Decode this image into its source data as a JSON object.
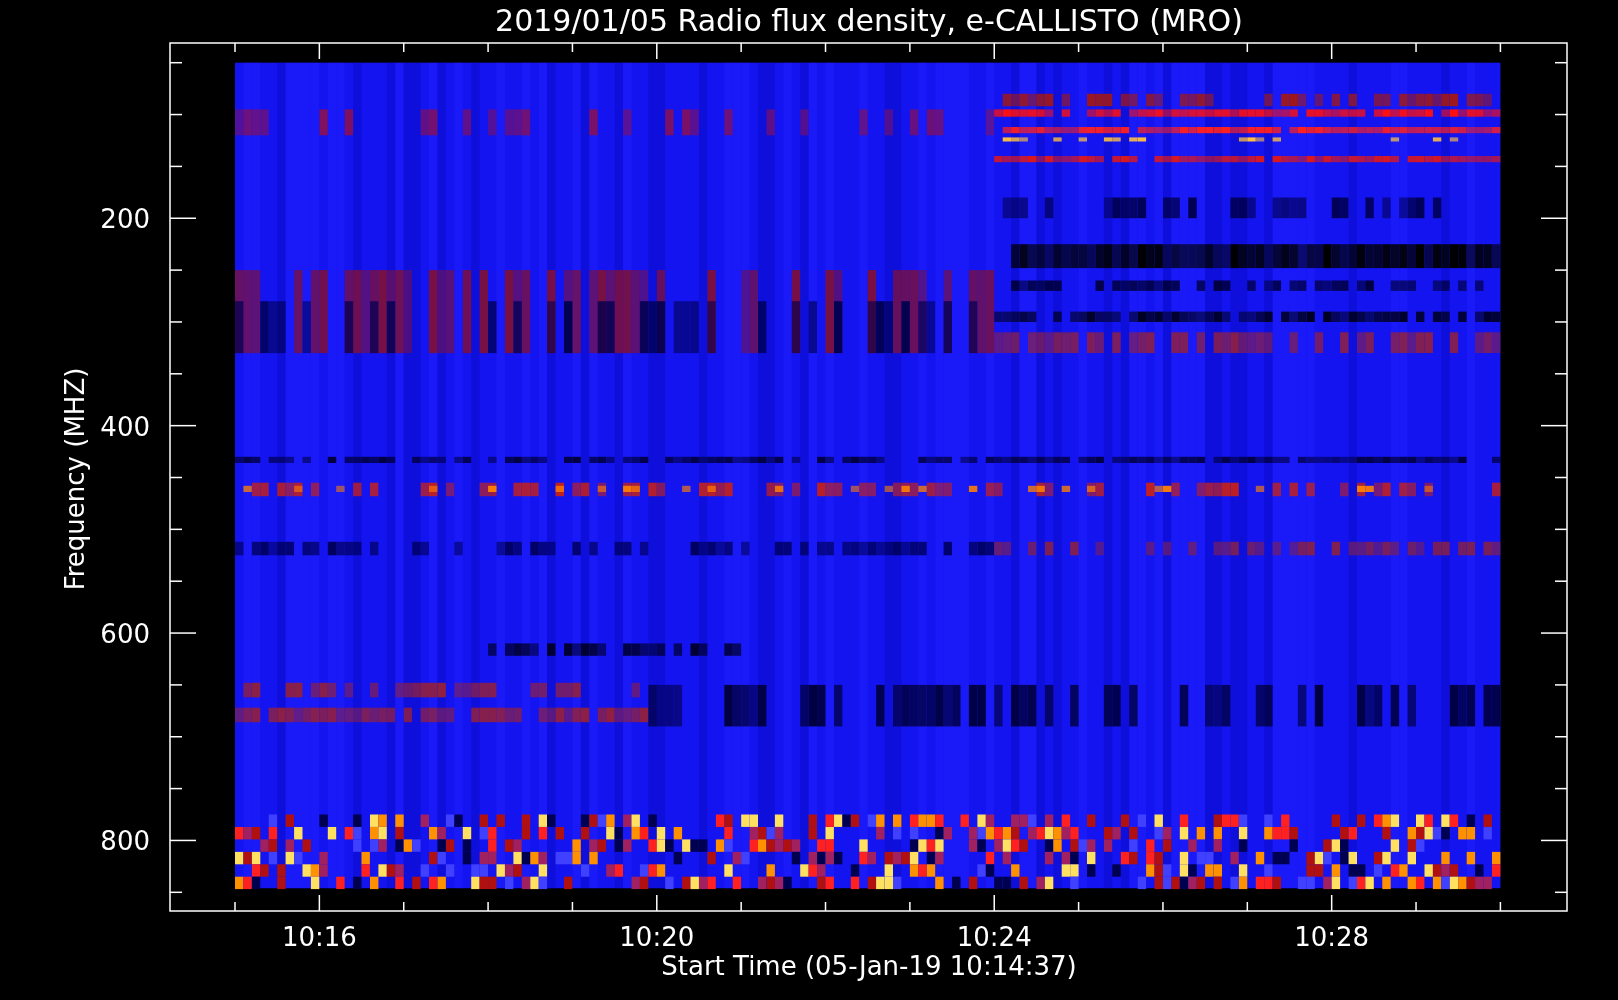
{
  "title": "2019/01/05  Radio flux density, e-CALLISTO (MRO)",
  "x_axis": {
    "label": "Start Time (05-Jan-19 10:14:37)",
    "ticks": [
      "10:16",
      "10:20",
      "10:24",
      "10:28"
    ]
  },
  "y_axis": {
    "label": "Frequency (MHZ)",
    "ticks": [
      "200",
      "400",
      "600",
      "800"
    ]
  }
}
